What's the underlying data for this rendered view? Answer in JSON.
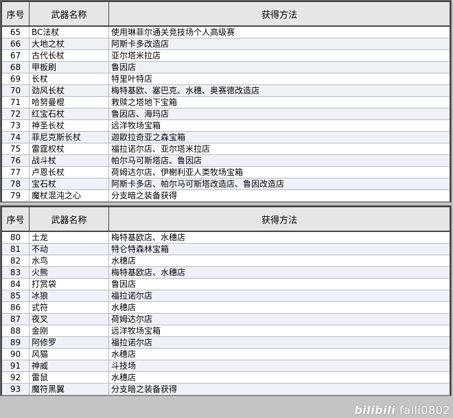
{
  "header": {
    "no": "序号",
    "name": "武器名称",
    "method": "获得方法"
  },
  "table1": [
    {
      "no": "65",
      "name": "BC法杖",
      "method": "使用琳菲尔通关竞技场个人高级赛"
    },
    {
      "no": "66",
      "name": "大地之杖",
      "method": "阿斯卡多改造店"
    },
    {
      "no": "67",
      "name": "古代长杖",
      "method": "亚尔塔米拉店"
    },
    {
      "no": "68",
      "name": "甲板刷",
      "method": "鲁因店"
    },
    {
      "no": "69",
      "name": "长杖",
      "method": "特里叶特店"
    },
    {
      "no": "70",
      "name": "劲风长杖",
      "method": "梅特基欧、塞巴克、水穗、奥赛德改造店"
    },
    {
      "no": "71",
      "name": "哈努曼棍",
      "method": "救赎之塔地下宝箱"
    },
    {
      "no": "72",
      "name": "红宝石杖",
      "method": "鲁因店、海玛店"
    },
    {
      "no": "73",
      "name": "神圣长杖",
      "method": "远洋牧场宝箱"
    },
    {
      "no": "74",
      "name": "菲尼克斯长杖",
      "method": "迦歐拉奇亚之森宝箱"
    },
    {
      "no": "75",
      "name": "雷霆权杖",
      "method": "福拉诺尔店、亚尔塔米拉店"
    },
    {
      "no": "76",
      "name": "战斗杖",
      "method": "帕尔马可斯塔店、鲁因店"
    },
    {
      "no": "77",
      "name": "卢恩长杖",
      "method": "荷姆达尔店、伊榭利亚人类牧场宝箱"
    },
    {
      "no": "78",
      "name": "宝石杖",
      "method": "阿斯卡多店、帕尔马可斯塔改造店、鲁因改造店"
    },
    {
      "no": "79",
      "name": "魔杖混沌之心",
      "method": "分支暗之装备获得"
    }
  ],
  "table2": [
    {
      "no": "80",
      "name": "土龙",
      "method": "梅特基欧店、水穗店"
    },
    {
      "no": "81",
      "name": "不动",
      "method": "特仑特森林宝箱"
    },
    {
      "no": "82",
      "name": "水鸟",
      "method": "水穗店"
    },
    {
      "no": "83",
      "name": "火熊",
      "method": "梅特基欧店、水穗店"
    },
    {
      "no": "84",
      "name": "打赏袋",
      "method": "鲁因店"
    },
    {
      "no": "85",
      "name": "冰狼",
      "method": "福拉诺尔店"
    },
    {
      "no": "86",
      "name": "式符",
      "method": "水穗店"
    },
    {
      "no": "87",
      "name": "夜叉",
      "method": "荷姆达尔店"
    },
    {
      "no": "88",
      "name": "金刚",
      "method": "远洋牧场宝箱"
    },
    {
      "no": "89",
      "name": "阿修罗",
      "method": "福拉诺尔店"
    },
    {
      "no": "90",
      "name": "风猫",
      "method": "水穗店"
    },
    {
      "no": "91",
      "name": "神威",
      "method": "斗技场"
    },
    {
      "no": "92",
      "name": "雷鼠",
      "method": "水穗店"
    },
    {
      "no": "93",
      "name": "魔符黑翼",
      "method": "分支暗之装备获得"
    }
  ],
  "watermark": {
    "logo": "bilibili",
    "user": "faili0802"
  }
}
